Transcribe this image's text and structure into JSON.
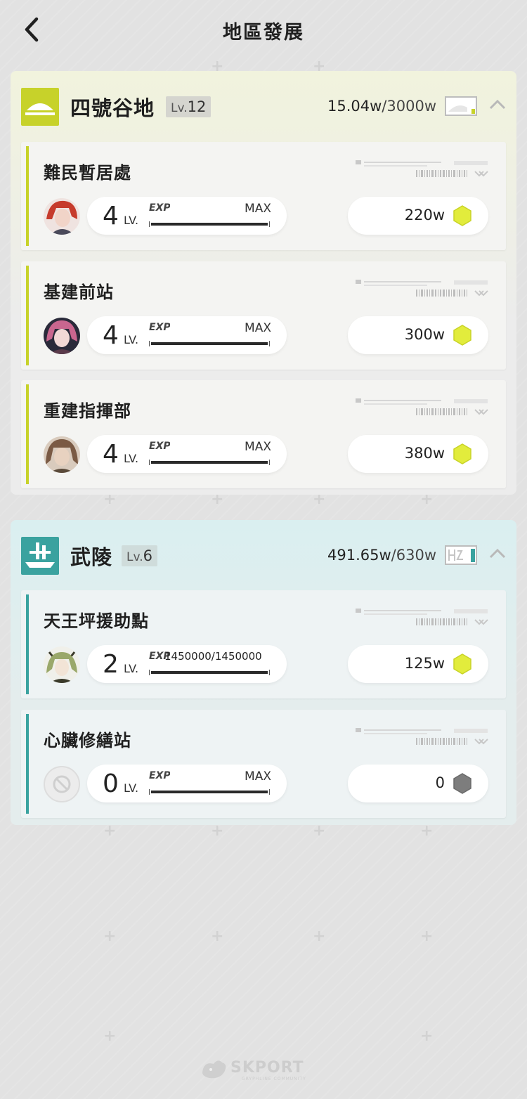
{
  "header": {
    "title": "地區發展"
  },
  "regions": [
    {
      "name": "四號谷地",
      "lv_prefix": "Lv.",
      "level": "12",
      "storage_current": "15.04w",
      "storage_cap": "/3000w",
      "facilities": [
        {
          "name": "難民暫居處",
          "level": "4",
          "lv_unit": "LV.",
          "exp": "MAX",
          "exp_fraction": 1.0,
          "cost": "220w",
          "avatar": "character-red-hair",
          "avatar_colors": [
            "#c63b2c",
            "#f1d4c8"
          ]
        },
        {
          "name": "基建前站",
          "level": "4",
          "lv_unit": "LV.",
          "exp": "MAX",
          "exp_fraction": 1.0,
          "cost": "300w",
          "avatar": "character-pink-hair",
          "avatar_colors": [
            "#c9668f",
            "#2a2a3a"
          ]
        },
        {
          "name": "重建指揮部",
          "level": "4",
          "lv_unit": "LV.",
          "exp": "MAX",
          "exp_fraction": 1.0,
          "cost": "380w",
          "avatar": "character-brown-hair",
          "avatar_colors": [
            "#7a5a44",
            "#e8d2c0"
          ]
        }
      ]
    },
    {
      "name": "武陵",
      "lv_prefix": "Lv.",
      "level": "6",
      "storage_current": "491.65w",
      "storage_cap": "/630w",
      "facilities": [
        {
          "name": "天王坪援助點",
          "level": "2",
          "lv_unit": "LV.",
          "exp": "1450000/1450000",
          "exp_fraction": 1.0,
          "cost": "125w",
          "avatar": "character-green-hair",
          "avatar_colors": [
            "#9aa86a",
            "#3a3a2a"
          ]
        },
        {
          "name": "心臟修繕站",
          "level": "0",
          "lv_unit": "LV.",
          "exp": "MAX",
          "exp_fraction": 1.0,
          "cost": "0",
          "avatar": "empty-slot-icon",
          "avatar_colors": [
            "#cfcfcf",
            "#ececec"
          ]
        }
      ]
    }
  ],
  "colors": {
    "accent_valley": "#c7d22a",
    "accent_wuling": "#3aa29f",
    "currency_active": "#e2ec3c",
    "currency_inactive": "#7d7d7d"
  },
  "footer": {
    "brand": "SKPORT",
    "sub": "GRYPHLINE COMMUNITY"
  }
}
